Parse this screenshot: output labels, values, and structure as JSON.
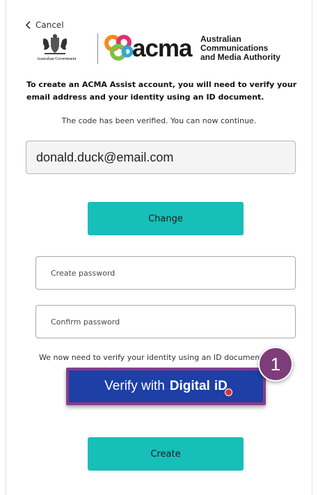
{
  "nav": {
    "cancel_label": "Cancel"
  },
  "logos": {
    "gov_text": "Australian Government",
    "acma_wordmark": "acma",
    "authority_line1": "Australian",
    "authority_line2": "Communications",
    "authority_line3": "and Media Authority"
  },
  "intro_text": "To create an ACMA Assist account, you will need to verify your email address and your identity using an ID document.",
  "verified_message": "The code has been verified. You can now continue.",
  "email": {
    "value": "donald.duck@email.com"
  },
  "change_button": "Change",
  "password": {
    "placeholder": "Create password"
  },
  "confirm_password": {
    "placeholder": "Confirm password"
  },
  "id_note": "We now need to verify your identity using an ID document.",
  "digital_id": {
    "prefix": "Verify with",
    "brand": "Digital",
    "logo": "iD"
  },
  "step_badge": "1",
  "create_button": "Create",
  "colors": {
    "teal": "#17bfb9",
    "digital_id_blue": "#1d3fa6",
    "highlight_purple": "#7d3c7a"
  }
}
